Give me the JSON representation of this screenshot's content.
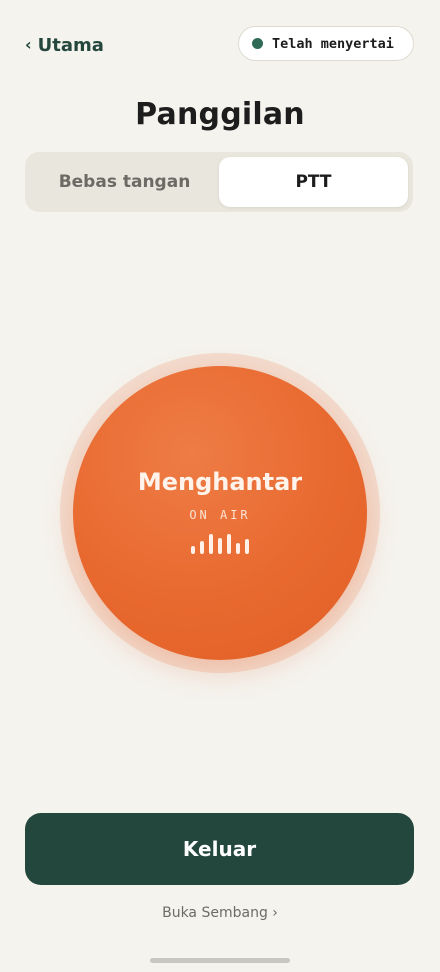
{
  "header": {
    "back_label": "Utama",
    "back_chevron": "‹",
    "status": {
      "label": "Telah menyertai",
      "color": "#2e6a55"
    }
  },
  "title": "Panggilan",
  "mode_tabs": [
    {
      "label": "Bebas tangan",
      "active": false
    },
    {
      "label": "PTT",
      "active": true
    }
  ],
  "ptt": {
    "label": "Menghantar",
    "sub_label": "ON AIR",
    "level_bars": [
      8,
      13,
      20,
      16,
      20,
      11,
      15
    ],
    "accent": "#e8692f"
  },
  "leave_label": "Keluar",
  "chat_link": {
    "label": "Buka Sembang",
    "chevron": "›"
  },
  "colors": {
    "primary": "#24473d",
    "background": "#f5f3ee"
  }
}
